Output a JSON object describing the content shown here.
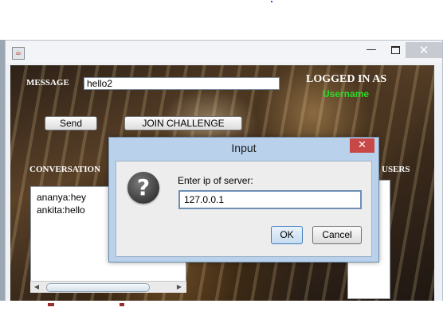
{
  "window": {
    "icon": "java-cup-icon",
    "minimize": "minimize-icon",
    "maximize": "maximize-icon",
    "close": "close-icon"
  },
  "main": {
    "message_label": "MESSAGE",
    "message_value": "hello2",
    "logged_in_label": "LOGGED IN AS",
    "username": "Username",
    "send_label": "Send",
    "join_label": "JOIN CHALLENGE",
    "conversation_label": "CONVERSATION",
    "users_label": "USERS",
    "conversation": [
      "ananya:hey",
      "ankita:hello"
    ]
  },
  "dialog": {
    "title": "Input",
    "icon": "question-icon",
    "prompt": "Enter ip of server:",
    "value": "127.0.0.1",
    "ok_label": "OK",
    "cancel_label": "Cancel"
  },
  "colors": {
    "username": "#2bdc28",
    "dialog_frame": "#b9d1ea",
    "close_button": "#c84747"
  }
}
